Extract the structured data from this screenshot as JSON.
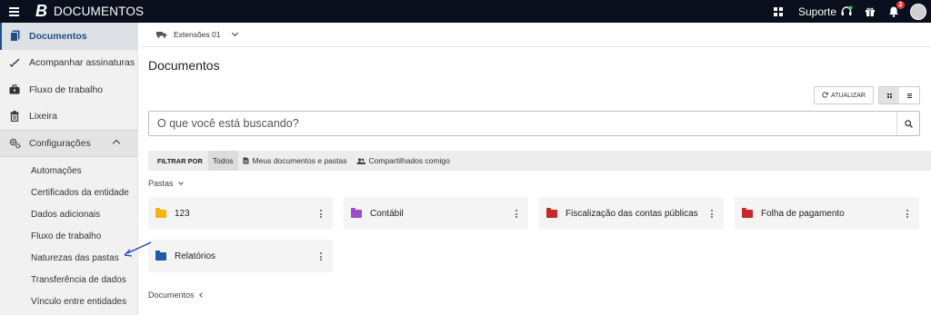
{
  "topbar": {
    "logo": "B",
    "title": "DOCUMENTOS",
    "support_label": "Suporte",
    "notification_count": "2"
  },
  "sidebar": {
    "items": [
      {
        "label": "Documentos",
        "icon": "document-icon"
      },
      {
        "label": "Acompanhar assinaturas",
        "icon": "signature-icon"
      },
      {
        "label": "Fluxo de trabalho",
        "icon": "briefcase-icon"
      },
      {
        "label": "Lixeira",
        "icon": "trash-icon"
      },
      {
        "label": "Configurações",
        "icon": "settings-icon"
      }
    ],
    "sub_items": [
      "Automações",
      "Certificados da entidade",
      "Dados adicionais",
      "Fluxo de trabalho",
      "Naturezas das pastas",
      "Transferência de dados",
      "Vínculo entre entidades"
    ]
  },
  "entity": {
    "name": "Extensões 01"
  },
  "main": {
    "title": "Documentos",
    "refresh_label": "ATUALIZAR",
    "search_placeholder": "O que você está buscando?",
    "filter": {
      "label": "FILTRAR POR",
      "options": [
        "Todos",
        "Meus documentos e pastas",
        "Compartilhados comigo"
      ],
      "selected": "Todos"
    },
    "folders_heading": "Pastas",
    "folders": [
      {
        "name": "123",
        "color": "#f5b50f"
      },
      {
        "name": "Contábil",
        "color": "#9b4dca"
      },
      {
        "name": "Fiscalização das contas públicas",
        "color": "#c62828"
      },
      {
        "name": "Folha de pagamento",
        "color": "#c62828"
      },
      {
        "name": "Relatórios",
        "color": "#1f5aa6"
      }
    ],
    "documents_heading": "Documentos"
  },
  "colors": {
    "topbar_bg": "#0a0f1e",
    "accent": "#1f4e8c",
    "annotation_arrow": "#1a3fd8"
  }
}
